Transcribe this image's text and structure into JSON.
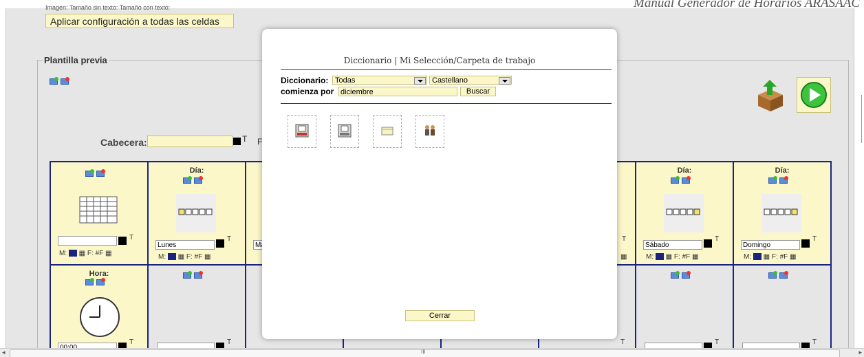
{
  "document": {
    "header_title": "Manual Generador de Horarios ARASAAC",
    "clipped_text": "Imagen: Tamaño sin texto:   Tamaño con texto:"
  },
  "config": {
    "apply_button": "Aplicar configuración a todas las celdas"
  },
  "template": {
    "legend": "Plantilla previa",
    "header_label": "Cabecera:",
    "header_input_value": "",
    "header_f_label": "F"
  },
  "grid": {
    "day_label": "Día:",
    "hour_label": "Hora:",
    "days": [
      "Lunes",
      "Ma",
      "Sábado",
      "Domingo"
    ],
    "m_label": "M:",
    "f_label": "F:",
    "hashf": "#F",
    "time_value": "00:00"
  },
  "modal": {
    "title": "Diccionario | Mi Selección/Carpeta de trabajo",
    "dictionary_label": "Diccionario:",
    "dictionary_value": "Todas",
    "language_value": "Castellano",
    "starts_with_label": "comienza por",
    "search_value": "diciembre",
    "search_button": "Buscar",
    "results": [
      "calendar-icon",
      "calendar-page-icon",
      "envelope-icon",
      "people-icon"
    ],
    "close_button": "Cerrar"
  },
  "scrollbar": {
    "grip": "III"
  },
  "colors": {
    "field_bg": "#fbf7c9",
    "grid_border": "#1a237e",
    "page_bg": "#e6e6e6"
  }
}
